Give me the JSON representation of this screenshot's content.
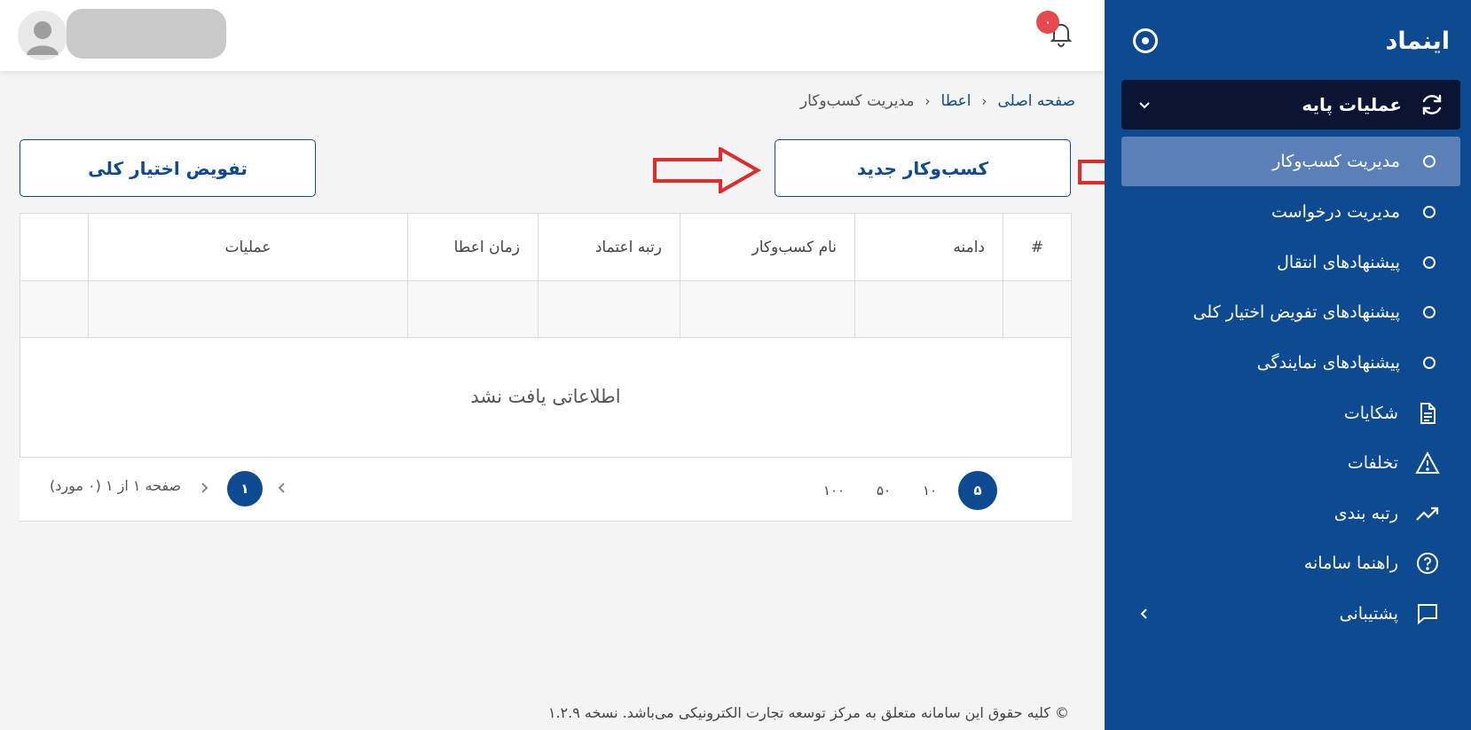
{
  "sidebar": {
    "brand": "اینماد",
    "group_label": "عملیات پایه",
    "items": [
      {
        "label": "مدیریت کسب‌وکار"
      },
      {
        "label": "مدیریت درخواست"
      },
      {
        "label": "پیشنهادهای انتقال"
      },
      {
        "label": "پیشنهادهای تفویض اختیار کلی"
      },
      {
        "label": "پیشنهادهای نمایندگی"
      },
      {
        "label": "شکایات"
      },
      {
        "label": "تخلفات"
      },
      {
        "label": "رتبه بندی"
      },
      {
        "label": "راهنما سامانه"
      },
      {
        "label": "پشتیبانی"
      }
    ]
  },
  "topbar": {
    "notification_count": "۰"
  },
  "breadcrumb": {
    "home": "صفحه اصلی",
    "section": "اعطا",
    "current": "مدیریت کسب‌وکار"
  },
  "actions": {
    "new_business": "کسب‌وکار جدید",
    "delegate_all": "تفویض اختیار کلی"
  },
  "table": {
    "headers": [
      "#",
      "دامنه",
      "نام کسب‌وکار",
      "رتبه اعتماد",
      "زمان اعطا",
      "عملیات",
      ""
    ],
    "empty_message": "اطلاعاتی یافت نشد"
  },
  "pager": {
    "page_sizes": [
      "۵",
      "۱۰",
      "۵۰",
      "۱۰۰"
    ],
    "current_page": "۱",
    "info": "صفحه ۱ از ۱ (۰ مورد)"
  },
  "footer": {
    "text": "© کلیه حقوق این سامانه متعلق به مرکز توسعه تجارت الکترونیکی می‌باشد. نسخه ۱.۲.۹"
  },
  "colors": {
    "sidebar_bg": "#0d4a91",
    "sidebar_group_bg": "#0b1433",
    "sidebar_active_bg": "#5b80b8",
    "accent": "#0d4a91",
    "annotation_arrow": "#e02b2b",
    "badge": "#e5484d"
  }
}
